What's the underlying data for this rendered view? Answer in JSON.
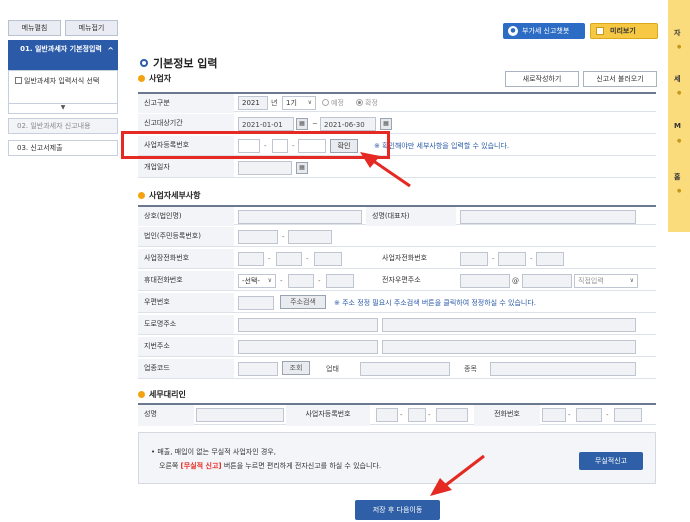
{
  "sidebar": {
    "expand_label": "메뉴펼침",
    "collapse_label": "메뉴접기",
    "step1_label": "01. 일반과세자 기본정입력",
    "step1_sub": "일반과세자 입력서식 선택",
    "step2_label": "02. 일반과세자 신고내용",
    "step3_label": "03. 신고서제출"
  },
  "top_buttons": {
    "chatbot": "부가세 신고챗봇",
    "preview": "미리보기"
  },
  "right_strip": {
    "labels": [
      "자",
      "세",
      "M",
      "홈"
    ]
  },
  "main": {
    "title": "기본정보 입력",
    "section_business": "사업자",
    "new_write": "새로작성하기",
    "load_report": "신고서 불러오기"
  },
  "basic": {
    "report_type_label": "신고구분",
    "year": "2021",
    "year_unit": "년",
    "period": "1기",
    "radio_forecast": "예정",
    "radio_final": "확정",
    "period_label": "신고대상기간",
    "date_from": "2021-01-01",
    "date_to": "2021-06-30",
    "brn_label": "사업자등록번호",
    "confirm": "확인",
    "brn_note": "※ 확인해야만 세부사항을 입력할 수 있습니다.",
    "open_date_label": "개업일자"
  },
  "detail": {
    "title": "사업자세부사항",
    "company_label": "상호(법인명)",
    "rep_label": "성명(대표자)",
    "corp_no_label": "법인(주민등록번호)",
    "biz_phone_label": "사업장전화번호",
    "home_phone_label": "사업자전화번호",
    "mobile_label": "휴대전화번호",
    "mobile_select": "-선택-",
    "email_label": "전자우편주소",
    "at": "@",
    "email_direct": "직접입력",
    "zip_label": "우편번호",
    "address_search": "주소검색",
    "zip_note": "※ 주소 정정 필요시 주소검색 버튼을 클릭하여 정정하실 수 있습니다.",
    "road_label": "도로명주소",
    "lot_label": "지번주소",
    "industry_label": "업종코드",
    "lookup": "조회",
    "business_type_label": "업태",
    "item_label": "종목"
  },
  "agent": {
    "title": "세무대리인",
    "name_label": "성명",
    "brn_label": "사업자등록번호",
    "phone_label": "전화번호"
  },
  "info": {
    "line1": "• 매출, 매입이 없는 무실적 사업자인 경우,",
    "line2_pre": "오른쪽 ",
    "line2_red": "[무실적 신고]",
    "line2_post": " 버튼을 누르면 편리하게 전자신고를 하실 수 있습니다.",
    "no_record_button": "무실적신고",
    "save_next": "저장 후 다음이동"
  },
  "colors": {
    "primary": "#2a5aa8",
    "highlight": "#e42a22",
    "accent": "#f2a30f",
    "preview": "#f6c843"
  }
}
